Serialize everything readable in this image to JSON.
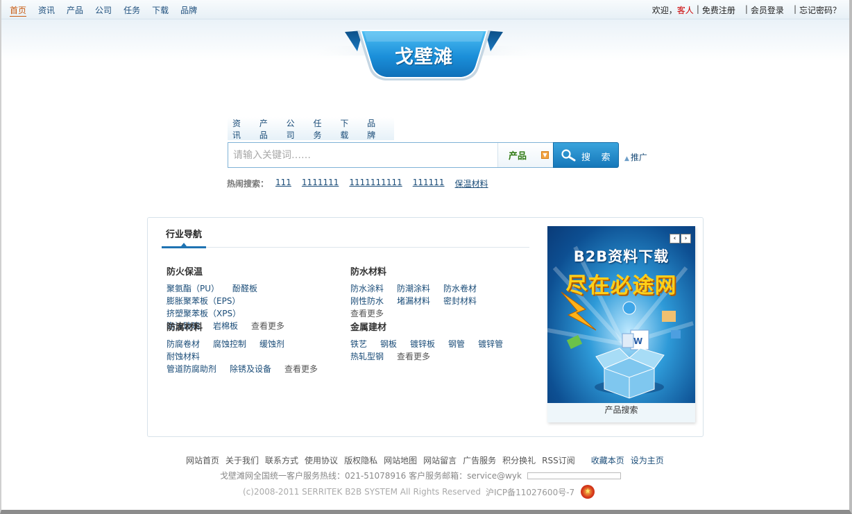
{
  "top_nav": {
    "items": [
      "首页",
      "资讯",
      "产品",
      "公司",
      "任务",
      "下载",
      "品牌"
    ],
    "active_index": 0
  },
  "user_links": {
    "welcome": "欢迎，",
    "guest": "客人",
    "register": "免费注册",
    "login": "会员登录",
    "forgot": "忘记密码？",
    "separator": "|"
  },
  "logo": {
    "text": "戈壁滩"
  },
  "search": {
    "tabs": [
      "资讯",
      "产品",
      "公司",
      "任务",
      "下载",
      "品牌"
    ],
    "placeholder": "请输入关键词……",
    "type_selected": "产品",
    "button_label": "搜 索",
    "promote": "推广",
    "hot_label": "热闹搜索：",
    "hot_terms": [
      "111",
      "1111111",
      "1111111111",
      "111111",
      "保温材料"
    ]
  },
  "industry": {
    "tab_label": "行业导航",
    "more_label": "查看更多",
    "categories": [
      {
        "title": "防火保温",
        "links": [
          "聚氨酯（PU）",
          "酚醛板",
          "膨胀聚苯板（EPS）",
          "挤塑聚苯板（XPS）",
          "泡沫玻璃",
          "岩棉板"
        ]
      },
      {
        "title": "防水材料",
        "links": [
          "防水涂料",
          "防潮涂料",
          "防水卷材",
          "刚性防水",
          "堵漏材料",
          "密封材料"
        ]
      },
      {
        "title": "防腐材料",
        "links": [
          "防腐卷材",
          "腐蚀控制",
          "缓蚀剂",
          "耐蚀材料",
          "管道防腐助剂",
          "除锈及设备"
        ]
      },
      {
        "title": "金属建材",
        "links": [
          "铁艺",
          "钢板",
          "镀锌板",
          "钢管",
          "镀锌管",
          "热轧型钢"
        ]
      }
    ]
  },
  "ad": {
    "title": "B2B资料下载",
    "slogan": "尽在必途网",
    "caption": "产品搜索",
    "prev": "‹",
    "next": "›"
  },
  "footer": {
    "links": [
      "网站首页",
      "关于我们",
      "联系方式",
      "使用协议",
      "版权隐私",
      "网站地图",
      "网站留言",
      "广告服务",
      "积分换礼",
      "RSS订阅"
    ],
    "extra_links": [
      "收藏本页",
      "设为主页"
    ],
    "line2": "戈壁滩网全国统一客户服务热线：021-51078916 客户服务邮箱：service@wyk",
    "copyright": "(c)2008-2011 SERRITEK B2B SYSTEM All Rights Reserved",
    "icp": "沪ICP备11027600号-7"
  },
  "colors": {
    "accent": "#1f73b2",
    "link": "#1a4c78",
    "active_nav": "#c85a10",
    "guest": "#cc0000"
  }
}
